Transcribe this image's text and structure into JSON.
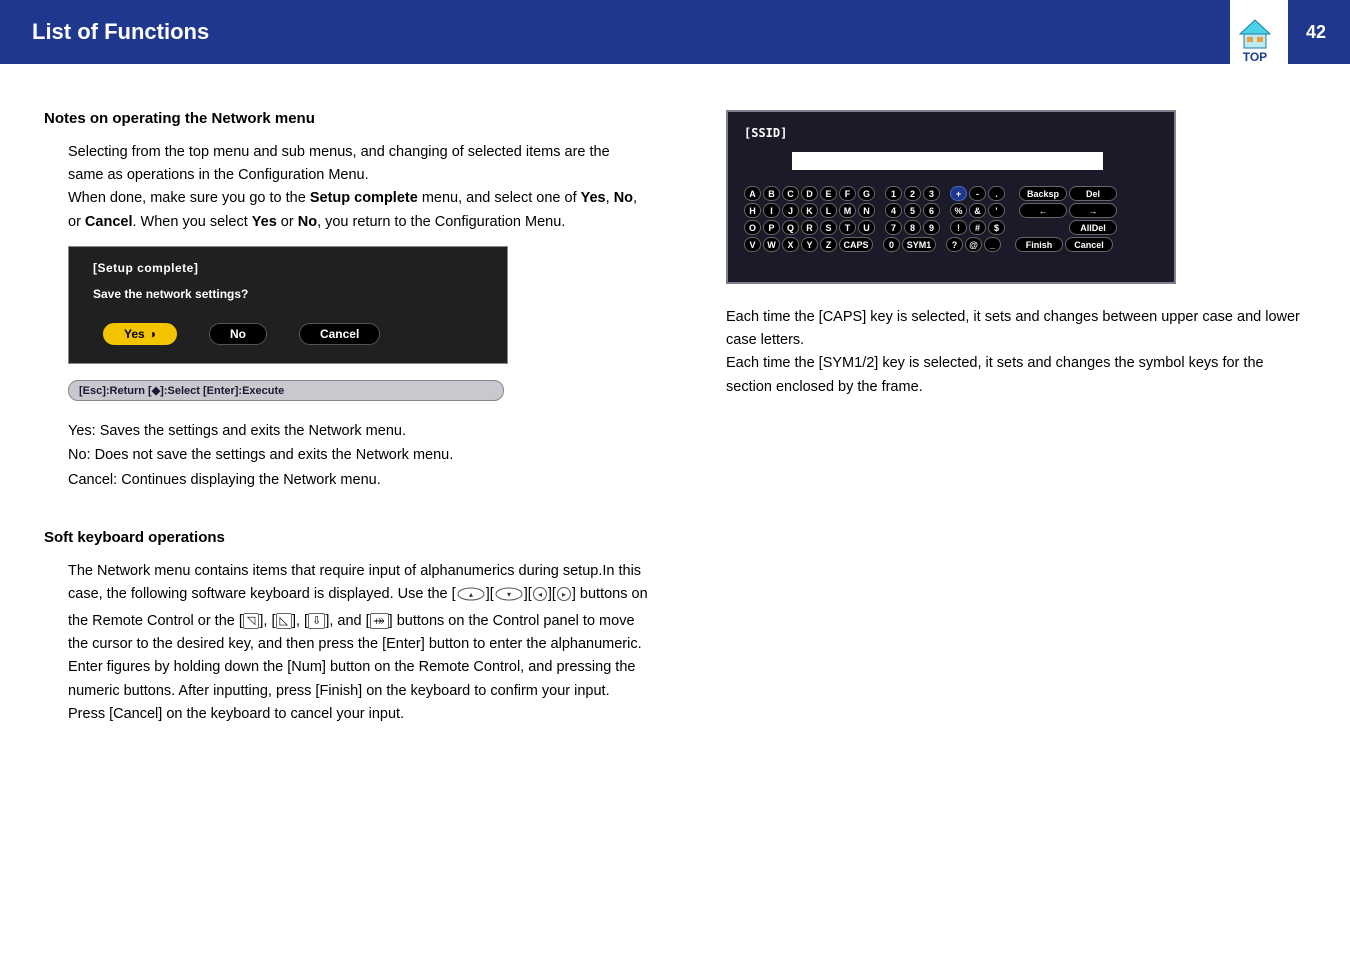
{
  "header": {
    "title": "List of Functions",
    "page": "42",
    "top_label": "TOP"
  },
  "left": {
    "h_notes": "Notes on operating the Network menu",
    "p1a": "Selecting from the top menu and sub menus, and changing of selected items are the same as operations in the Configuration Menu.",
    "p1b_pre": "When done, make sure you go to the ",
    "p1b_bold1": "Setup complete",
    "p1b_mid": " menu, and select one of ",
    "yes": "Yes",
    "no": "No",
    "cancel": "Cancel",
    "p1b_or1": ", ",
    "p1b_or2": ", or ",
    "p1b_after": ". When you select ",
    "p1b_or3": " or ",
    "p1b_end": ", you return to the Configuration Menu.",
    "setup_title": "[Setup complete]",
    "setup_q": "Save the network settings?",
    "btn_yes": "Yes",
    "btn_no": "No",
    "btn_cancel": "Cancel",
    "setup_footer": "[Esc]:Return  [◆]:Select  [Enter]:Execute",
    "yn_yes": "Yes: Saves the settings and exits the Network menu.",
    "yn_no": "No: Does not save the settings and exits the Network menu.",
    "yn_cancel": "Cancel: Continues displaying the Network menu.",
    "h_soft": "Soft keyboard operations",
    "soft_p1": "The Network menu contains items that require input of alphanumerics during setup.In this case, the following software keyboard is displayed. Use the [",
    "soft_p1_mid": "] buttons on the Remote Control or the [",
    "soft_g1": "⌔",
    "soft_g2": "⌔",
    "soft_g3": "⇽",
    "soft_g4": "⤀",
    "soft_p1_mid2": "], [",
    "soft_p1_mid3": "], and [",
    "soft_p1_end": "] buttons on the Control panel to move the cursor to the desired key, and then press the [Enter] button to enter the alphanumeric. Enter figures by holding down the [Num] button on the Remote Control, and pressing the numeric buttons. After inputting, press [Finish] on the keyboard to confirm your input. Press [Cancel] on the keyboard to cancel your input."
  },
  "right": {
    "ssid": "[SSID]",
    "rows": [
      {
        "main": [
          "A",
          "B",
          "C",
          "D",
          "E",
          "F",
          "G"
        ],
        "num": [
          "1",
          "2",
          "3"
        ],
        "sym": [
          "+",
          "-",
          "."
        ],
        "ext": [
          "Backsp",
          "Del"
        ]
      },
      {
        "main": [
          "H",
          "I",
          "J",
          "K",
          "L",
          "M",
          "N"
        ],
        "num": [
          "4",
          "5",
          "6"
        ],
        "sym": [
          "%",
          "&",
          "'"
        ],
        "ext": [
          "←",
          "→"
        ]
      },
      {
        "main": [
          "O",
          "P",
          "Q",
          "R",
          "S",
          "T",
          "U"
        ],
        "num": [
          "7",
          "8",
          "9"
        ],
        "sym": [
          "!",
          "#",
          "$"
        ],
        "ext": [
          "",
          "AllDel"
        ]
      },
      {
        "main": [
          "V",
          "W",
          "X",
          "Y",
          "Z",
          "CAPS"
        ],
        "num": [
          "0",
          "SYM1"
        ],
        "sym": [
          "?",
          "@",
          "_"
        ],
        "ext": [
          "Finish",
          "Cancel"
        ]
      }
    ],
    "caps_note": "Each time the [CAPS] key is selected, it sets and changes between upper case and lower case letters.",
    "sym_note": "Each time the [SYM1/2] key is selected, it sets and changes the symbol keys for the section enclosed by the frame."
  }
}
